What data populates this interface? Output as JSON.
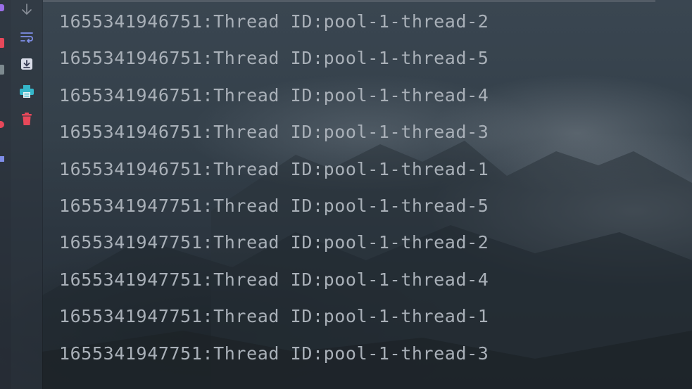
{
  "colors": {
    "console_text": "#a9b0b8",
    "toolbar_icon_blue": "#7f8ee8",
    "toolbar_icon_cyan": "#35b6c9",
    "toolbar_icon_red": "#e8485a",
    "toolbar_icon_gray": "#8a9099"
  },
  "toolbar": {
    "icons": [
      "arrow-down-icon",
      "soft-wrap-icon",
      "import-icon",
      "print-icon",
      "trash-icon"
    ]
  },
  "console": {
    "lines": [
      "1655341946751:Thread ID:pool-1-thread-2",
      "1655341946751:Thread ID:pool-1-thread-5",
      "1655341946751:Thread ID:pool-1-thread-4",
      "1655341946751:Thread ID:pool-1-thread-3",
      "1655341946751:Thread ID:pool-1-thread-1",
      "1655341947751:Thread ID:pool-1-thread-5",
      "1655341947751:Thread ID:pool-1-thread-2",
      "1655341947751:Thread ID:pool-1-thread-4",
      "1655341947751:Thread ID:pool-1-thread-1",
      "1655341947751:Thread ID:pool-1-thread-3"
    ]
  }
}
